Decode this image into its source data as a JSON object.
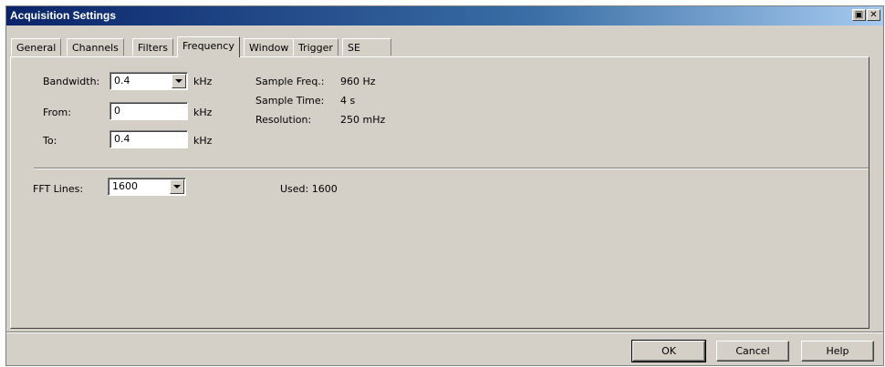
{
  "window": {
    "title": "Acquisition Settings"
  },
  "title_buttons": {
    "restore_glyph": "▣",
    "close_glyph": "✕"
  },
  "tabs": [
    {
      "label": "General"
    },
    {
      "label": "Channels"
    },
    {
      "label": "Filters"
    },
    {
      "label": "Frequency",
      "active": true
    },
    {
      "label": "Window"
    },
    {
      "label": "Trigger"
    },
    {
      "label": "SE"
    }
  ],
  "frequency": {
    "bandwidth_label": "Bandwidth:",
    "bandwidth_value": "0.4",
    "bandwidth_unit": "kHz",
    "from_label": "From:",
    "from_value": "0",
    "from_unit": "kHz",
    "to_label": "To:",
    "to_value": "0.4",
    "to_unit": "kHz",
    "sample_freq_label": "Sample Freq.:",
    "sample_freq_value": "960 Hz",
    "sample_time_label": "Sample Time:",
    "sample_time_value": "4 s",
    "resolution_label": "Resolution:",
    "resolution_value": "250 mHz",
    "fft_lines_label": "FFT Lines:",
    "fft_lines_value": "1600",
    "used_text": "Used:  1600"
  },
  "buttons": {
    "ok": "OK",
    "cancel": "Cancel",
    "help": "Help"
  }
}
